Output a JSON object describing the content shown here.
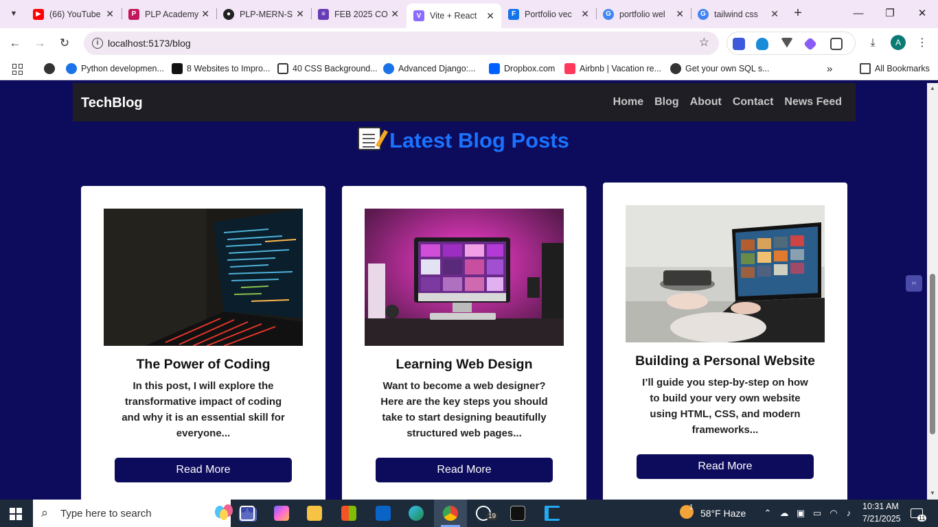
{
  "browser": {
    "tabs": [
      {
        "title": "(66) YouTube",
        "favicon": "youtube-icon",
        "color": "#ff0000"
      },
      {
        "title": "PLP Academy",
        "favicon": "plp-icon",
        "color": "#c2185b"
      },
      {
        "title": "PLP-MERN-S",
        "favicon": "github-icon",
        "color": "#222222"
      },
      {
        "title": "FEB 2025 CO",
        "favicon": "forms-icon",
        "color": "#673ab7"
      },
      {
        "title": "Vite + React",
        "favicon": "vite-icon",
        "color": "#8c6cff",
        "active": true
      },
      {
        "title": "Portfolio vec",
        "favicon": "freepik-icon",
        "color": "#1273eb"
      },
      {
        "title": "portfolio wel",
        "favicon": "google-icon",
        "color": "#4285f4"
      },
      {
        "title": "tailwind css",
        "favicon": "google-icon",
        "color": "#4285f4"
      }
    ],
    "url": "localhost:5173/blog",
    "profile_initial": "A",
    "bookmarks": [
      {
        "label": "Python developmen...",
        "color": "#1a73e8"
      },
      {
        "label": "8 Websites to Impro...",
        "color": "#111111"
      },
      {
        "label": "40 CSS Background...",
        "color": "#333333"
      },
      {
        "label": "Advanced Django:...",
        "color": "#1a73e8"
      },
      {
        "label": "Dropbox.com",
        "color": "#0061ff"
      },
      {
        "label": "Airbnb | Vacation re...",
        "color": "#ff385c"
      },
      {
        "label": "Get your own SQL s...",
        "color": "#333333"
      }
    ],
    "all_bookmarks": "All Bookmarks"
  },
  "site": {
    "brand": "TechBlog",
    "nav": [
      "Home",
      "Blog",
      "About",
      "Contact",
      "News Feed"
    ],
    "heading": "Latest Blog Posts",
    "posts": [
      {
        "title": "The Power of Coding",
        "excerpt": "In this post, I will explore the transformative impact of coding and why it is an essential skill for everyone...",
        "button": "Read More"
      },
      {
        "title": "Learning Web Design",
        "excerpt": "Want to become a web designer? Here are the key steps you should take to start designing beautifully structured web pages...",
        "button": "Read More"
      },
      {
        "title": "Building a Personal Website",
        "excerpt": "I’ll guide you step-by-step on how to build your very own website using HTML, CSS, and modern frameworks...",
        "button": "Read More"
      }
    ]
  },
  "taskbar": {
    "search_placeholder": "Type here to search",
    "weather": "58°F  Haze",
    "weather_badge": "1",
    "whatsapp_badge": "19",
    "time": "10:31 AM",
    "date": "7/21/2025",
    "notification_count": "11"
  },
  "colors": {
    "page_bg": "#0d0b5c",
    "nav_bg": "#1e1e24",
    "heading": "#1a73ff",
    "button": "#0d0b5c"
  }
}
